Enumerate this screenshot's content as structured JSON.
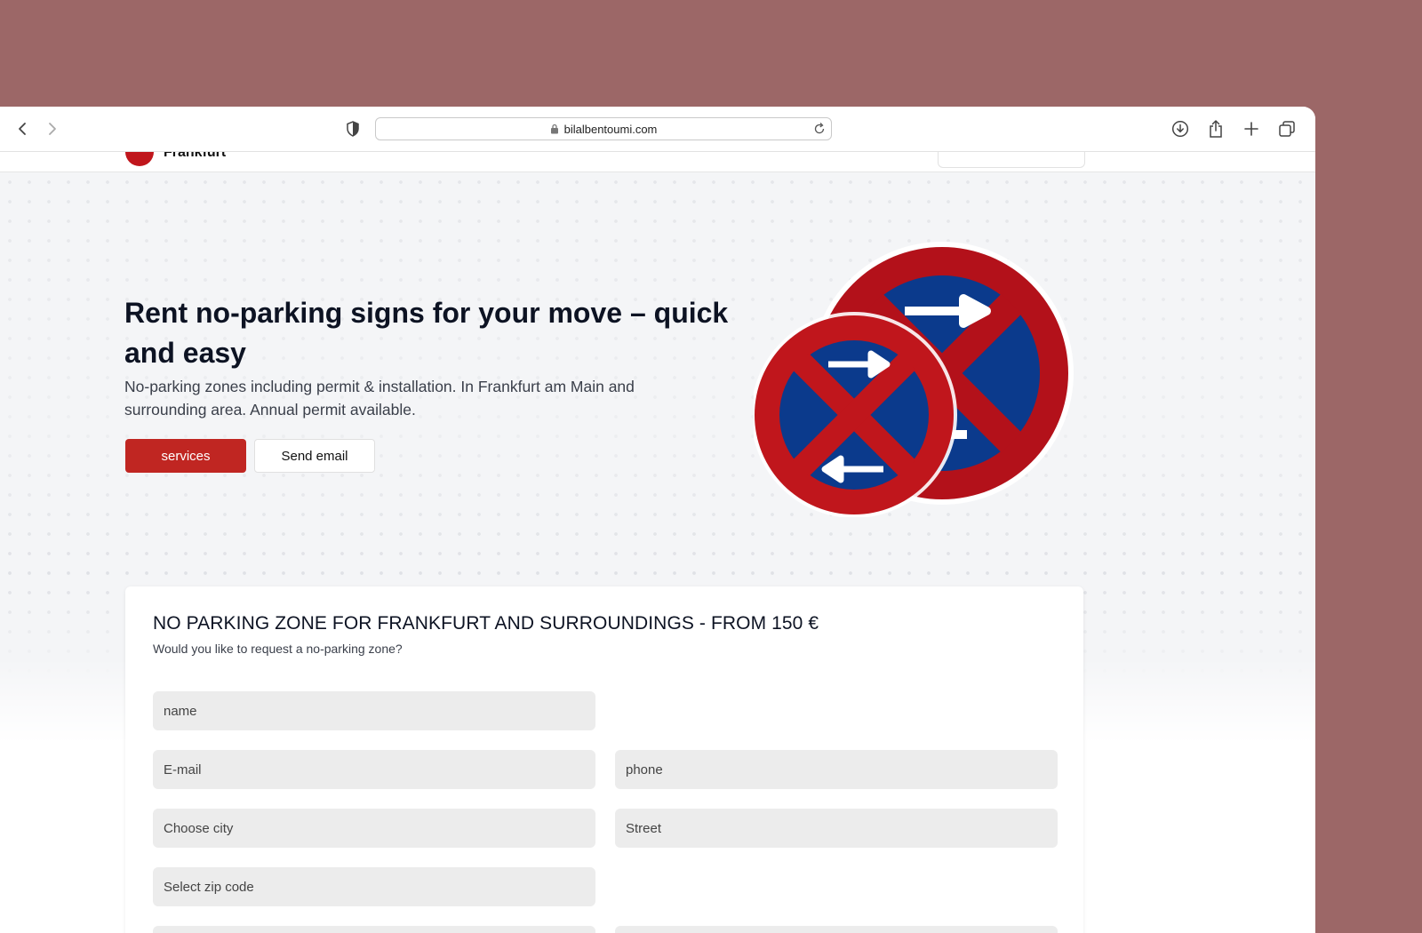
{
  "browser": {
    "url": "bilalbentoumi.com"
  },
  "header": {
    "logo_text": "Frankfurt"
  },
  "hero": {
    "title": "Rent no-parking signs for your move – quick and easy",
    "subtitle": "No-parking zones including permit & installation. In Frankfurt am Main and surrounding area. Annual permit available.",
    "primary_button": "services",
    "secondary_button": "Send email"
  },
  "form": {
    "title": "NO PARKING ZONE FOR FRANKFURT AND SURROUNDINGS - FROM 150 €",
    "subtitle": "Would you like to request a no-parking zone?",
    "placeholders": {
      "name": "name",
      "email": "E-mail",
      "phone": "phone",
      "city": "Choose city",
      "street": "Street",
      "zip": "Select zip code"
    }
  },
  "colors": {
    "background": "#9c6767",
    "brand_red": "#c02622",
    "sign_red": "#c0161c",
    "sign_blue": "#0b3a8c",
    "field_bg": "#ececec"
  }
}
